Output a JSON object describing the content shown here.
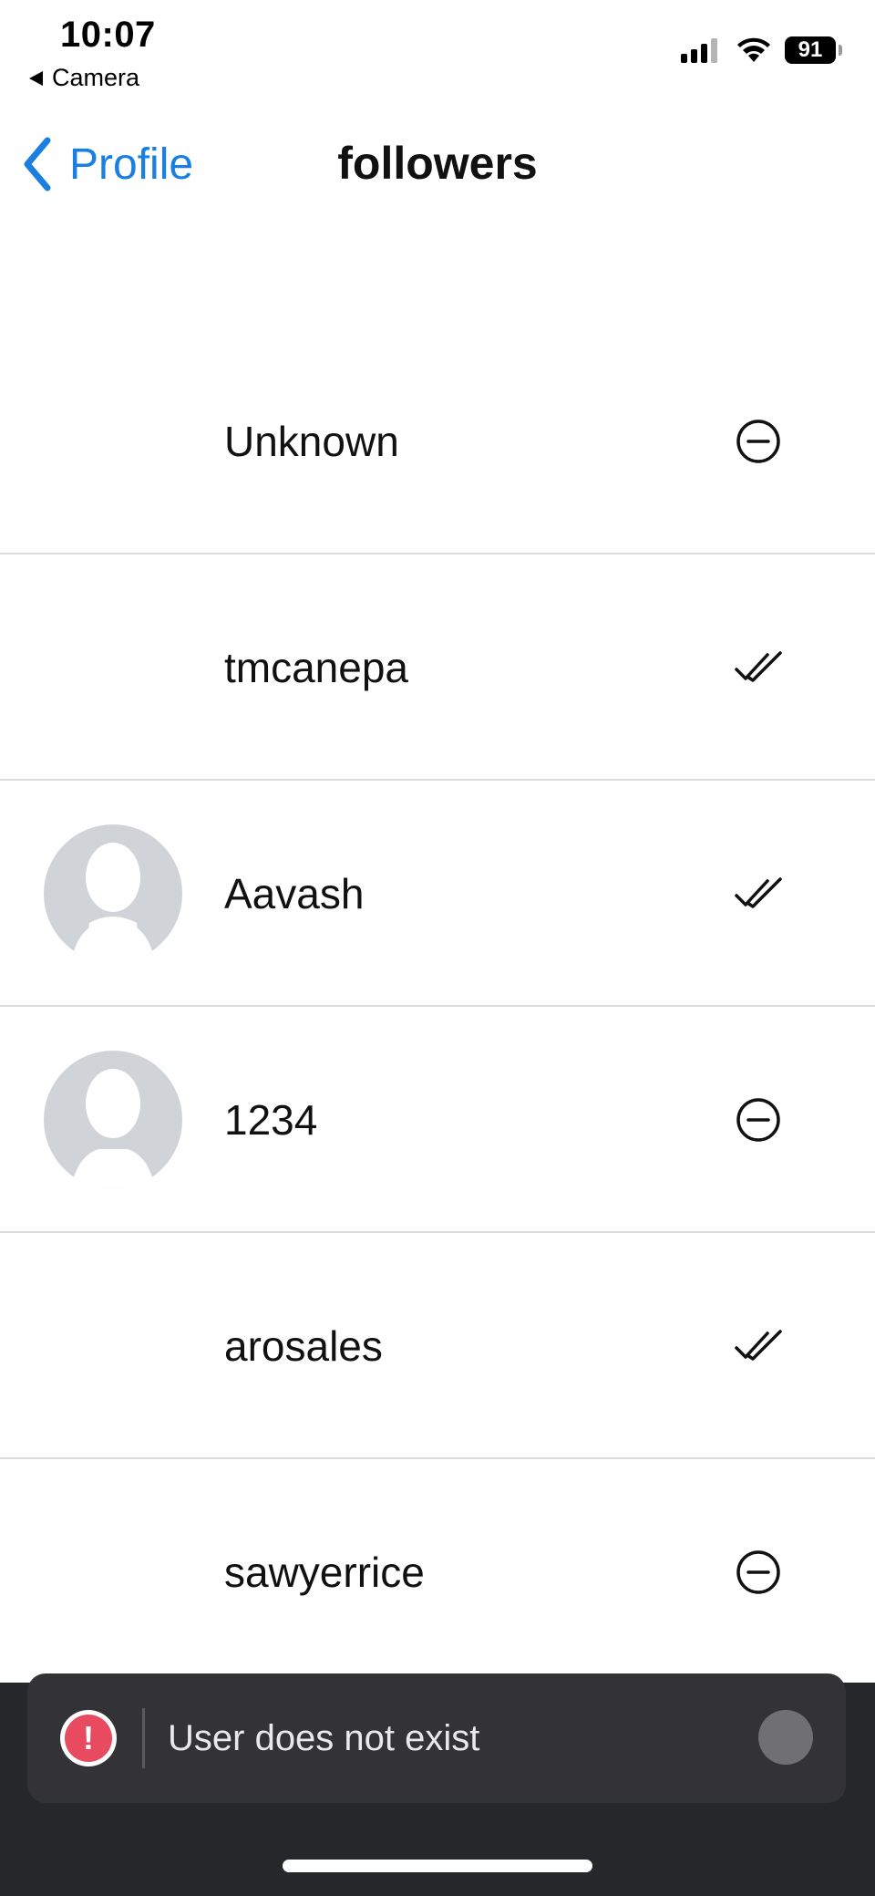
{
  "status_bar": {
    "time": "10:07",
    "back_app": "Camera",
    "battery": "91"
  },
  "nav": {
    "back_label": "Profile",
    "title": "followers"
  },
  "followers": [
    {
      "name": "Unknown",
      "has_avatar": false,
      "action": "remove"
    },
    {
      "name": "tmcanepa",
      "has_avatar": false,
      "action": "checked"
    },
    {
      "name": "Aavash",
      "has_avatar": true,
      "action": "checked"
    },
    {
      "name": "1234",
      "has_avatar": true,
      "action": "remove"
    },
    {
      "name": "arosales",
      "has_avatar": false,
      "action": "checked"
    },
    {
      "name": "sawyerrice",
      "has_avatar": false,
      "action": "remove"
    }
  ],
  "toast": {
    "icon": "!",
    "message": "User does not exist"
  },
  "colors": {
    "accent": "#1a7fe0",
    "toast_error": "#e84a5f",
    "bottom_panel": "#26272b"
  }
}
